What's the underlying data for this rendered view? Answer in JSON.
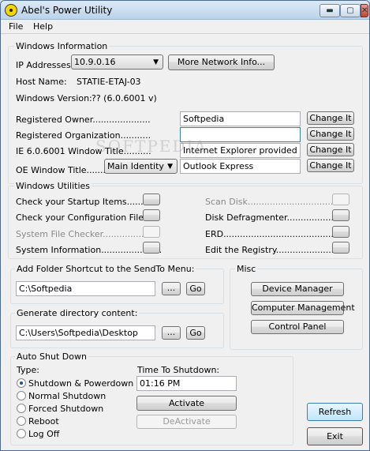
{
  "window": {
    "title": "Abel's Power Utility",
    "controls": {
      "minimize": "▬",
      "maximize": "▢",
      "close": "✕"
    }
  },
  "menu": [
    "File",
    "Help"
  ],
  "watermark": "SOFTPEDIA",
  "windows_info": {
    "title": "Windows Information",
    "ip_label": "IP Addresses:",
    "ip_value": "10.9.0.16",
    "more_info_button": "More Network Info...",
    "host_label": "Host Name:",
    "host_value": "STATIE-ETAJ-03",
    "version_label": "Windows Version:",
    "version_value": "?? (6.0.6001 v)",
    "rows": [
      {
        "label": "Registered Owner.....................",
        "value": "Softpedia",
        "button": "Change It"
      },
      {
        "label": "Registered Organization...........",
        "value": "",
        "button": "Change It"
      },
      {
        "label": "IE 6.0.6001 Window Title..........",
        "value": "Internet Explorer provided by D",
        "button": "Change It"
      },
      {
        "label": "OE Window Title........",
        "value": "Outlook Express",
        "button": "Change It"
      }
    ],
    "oe_combo": "Main Identity"
  },
  "utilities": {
    "title": "Windows Utilities",
    "left": [
      {
        "label": "Check your Startup Items............",
        "enabled": true
      },
      {
        "label": "Check your Configuration Files....",
        "enabled": true
      },
      {
        "label": "System File Checker....................",
        "enabled": false
      },
      {
        "label": "System Information......................",
        "enabled": true
      }
    ],
    "right": [
      {
        "label": "Scan Disk.................................",
        "enabled": false
      },
      {
        "label": "Disk Defragmenter.....................",
        "enabled": true
      },
      {
        "label": "ERD..........................................",
        "enabled": true
      },
      {
        "label": "Edit the Registry.........................",
        "enabled": true
      }
    ]
  },
  "sendto": {
    "title": "Add Folder Shortcut to the SendTo Menu:",
    "path": "C:\\Softpedia",
    "browse": "...",
    "go": "Go"
  },
  "gendir": {
    "title": "Generate directory content:",
    "path": "C:\\Users\\Softpedia\\Desktop",
    "browse": "...",
    "go": "Go"
  },
  "misc": {
    "title": "Misc",
    "buttons": [
      "Device Manager",
      "Computer Management",
      "Control Panel"
    ]
  },
  "shutdown": {
    "title": "Auto Shut Down",
    "type_label": "Type:",
    "options": [
      "Shutdown & Powerdown",
      "Normal Shutdown",
      "Forced Shutdown",
      "Reboot",
      "Log Off"
    ],
    "selected": 0,
    "time_label": "Time To Shutdown:",
    "time_value": "01:16 PM",
    "activate": "Activate",
    "deactivate": "DeActivate"
  },
  "footer": {
    "refresh": "Refresh",
    "exit": "Exit"
  }
}
